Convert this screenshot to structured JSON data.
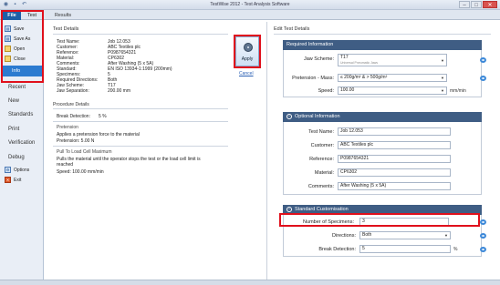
{
  "window": {
    "title": "TestWise 2012 - Test Analysis Software"
  },
  "ribbon": {
    "tabs": [
      "File",
      "Test",
      "Results"
    ]
  },
  "backstage": {
    "items": [
      {
        "label": "Save",
        "icon": "save-icon"
      },
      {
        "label": "Save As",
        "icon": "save-as-icon"
      },
      {
        "label": "Open",
        "icon": "open-folder-icon"
      },
      {
        "label": "Close",
        "icon": "close-folder-icon"
      }
    ],
    "info": "Info",
    "nav": [
      "Recent",
      "New",
      "Standards",
      "Print",
      "Verification",
      "Debug"
    ],
    "options": "Options",
    "exit": "Exit"
  },
  "test_details": {
    "title": "Test Details",
    "rows": [
      {
        "k": "Test Name:",
        "v": "Job 12.053"
      },
      {
        "k": "Customer:",
        "v": "ABC Textiles plc"
      },
      {
        "k": "Reference:",
        "v": "P0987654321"
      },
      {
        "k": "Material:",
        "v": "CP6302"
      },
      {
        "k": "Comments:",
        "v": "After Washing (5 x 5A)"
      },
      {
        "k": "Standard:",
        "v": "EN ISO 13934-1:1999 (200mm)"
      },
      {
        "k": "Specimens:",
        "v": "5"
      },
      {
        "k": "Required Directions:",
        "v": "Both"
      },
      {
        "k": "Jaw Scheme:",
        "v": "T17"
      },
      {
        "k": "Jaw Separation:",
        "v": "200.00 mm"
      }
    ]
  },
  "procedure": {
    "title": "Procedure Details",
    "break_label": "Break Detection:",
    "break_value": "5 %",
    "pretension_title": "Pretension",
    "pretension_desc": "Applies a pretension force to the material",
    "pretension_value": "Pretension:  5.00 N",
    "pull_title": "Pull To Load Cell Maximum",
    "pull_desc_1": "Pulls the material until the operator stops the test or the load cell limit is",
    "pull_desc_2": "reached",
    "speed": "Speed:  100.00 mm/min"
  },
  "actions": {
    "apply": "Apply",
    "cancel": "Cancel"
  },
  "edit": {
    "title": "Edit Test Details",
    "required": {
      "header": "Required Information",
      "jaw_label": "Jaw Scheme:",
      "jaw_value": "T17",
      "jaw_sub": "Universal Pneumatic Jaws",
      "pretension_label": "Pretension - Mass:",
      "pretension_value": "≤ 200g/m² & > 500g/m²",
      "speed_label": "Speed:",
      "speed_value": "100.00",
      "speed_unit": "mm/min"
    },
    "optional": {
      "header": "Optional Information",
      "test_name_label": "Test Name:",
      "test_name": "Job 12.053",
      "customer_label": "Customer:",
      "customer": "ABC Textiles plc",
      "reference_label": "Reference:",
      "reference": "P0987654321",
      "material_label": "Material:",
      "material": "CP6302",
      "comments_label": "Comments:",
      "comments": "After Washing (5 x 5A)"
    },
    "standard": {
      "header": "Standard Customisation",
      "specimens_label": "Number of Specimens:",
      "specimens": "3",
      "directions_label": "Directions:",
      "directions": "Both",
      "break_label": "Break Detection:",
      "break_value": "5",
      "break_unit": "%"
    }
  },
  "colors": {
    "accent": "#1e5fa7",
    "header": "#3f5d84",
    "highlight": "#e0101c"
  }
}
